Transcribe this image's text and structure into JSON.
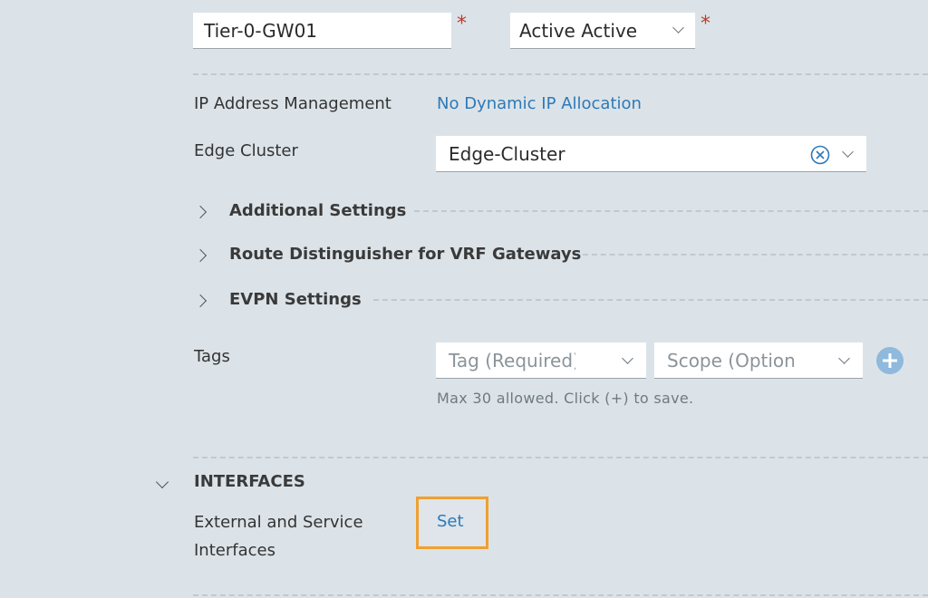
{
  "gateway": {
    "name_value": "Tier-0-GW01",
    "ha_mode_value": "Active Active",
    "required_mark": "*"
  },
  "ip_management": {
    "label": "IP Address Management",
    "value": "No Dynamic IP Allocation"
  },
  "edge_cluster": {
    "label": "Edge Cluster",
    "value": "Edge-Cluster"
  },
  "sections": [
    {
      "label": "Additional Settings"
    },
    {
      "label": "Route Distinguisher for VRF Gateways"
    },
    {
      "label": "EVPN Settings"
    }
  ],
  "tags": {
    "label": "Tags",
    "tag_placeholder": "Tag (Required)",
    "scope_placeholder": "Scope (Optional)",
    "hint": "Max 30 allowed. Click (+) to save."
  },
  "interfaces": {
    "title": "INTERFACES",
    "external_label_line1": "External and Service",
    "external_label_line2": "Interfaces",
    "set_label": "Set"
  },
  "colors": {
    "background": "#dce3e8",
    "link": "#2d79b8",
    "required": "#c0392b",
    "highlight": "#f0a030",
    "add_button": "#8fb9dd"
  }
}
